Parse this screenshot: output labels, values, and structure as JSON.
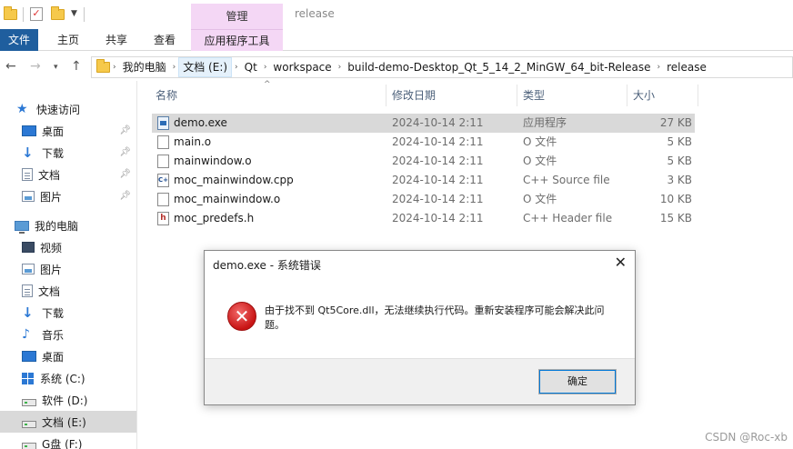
{
  "window": {
    "title": "release",
    "manage_tab": "管理"
  },
  "ribbon": {
    "tabs": [
      "文件",
      "主页",
      "共享",
      "查看",
      "应用程序工具"
    ]
  },
  "address": {
    "crumbs": [
      "我的电脑",
      "文档 (E:)",
      "Qt",
      "workspace",
      "build-demo-Desktop_Qt_5_14_2_MinGW_64_bit-Release",
      "release"
    ]
  },
  "sidebar": {
    "items": [
      {
        "label": "快速访问",
        "icon": "star-icon"
      },
      {
        "label": "桌面",
        "icon": "desktop-icon"
      },
      {
        "label": "下载",
        "icon": "download-icon"
      },
      {
        "label": "文档",
        "icon": "document-icon"
      },
      {
        "label": "图片",
        "icon": "picture-icon"
      },
      {
        "label": "我的电脑",
        "icon": "computer-icon"
      },
      {
        "label": "视频",
        "icon": "video-icon"
      },
      {
        "label": "图片",
        "icon": "picture-icon"
      },
      {
        "label": "文档",
        "icon": "document-icon"
      },
      {
        "label": "下载",
        "icon": "download-icon"
      },
      {
        "label": "音乐",
        "icon": "music-icon"
      },
      {
        "label": "桌面",
        "icon": "desktop-icon"
      },
      {
        "label": "系统 (C:)",
        "icon": "windows-drive-icon"
      },
      {
        "label": "软件 (D:)",
        "icon": "drive-icon"
      },
      {
        "label": "文档 (E:)",
        "icon": "drive-icon"
      },
      {
        "label": "G盘 (F:)",
        "icon": "drive-icon"
      }
    ]
  },
  "filelist": {
    "columns": {
      "name": "名称",
      "date": "修改日期",
      "type": "类型",
      "size": "大小"
    },
    "rows": [
      {
        "name": "demo.exe",
        "date": "2024-10-14 2:11",
        "type": "应用程序",
        "size": "27 KB",
        "icon": "exe-file-icon"
      },
      {
        "name": "main.o",
        "date": "2024-10-14 2:11",
        "type": "O 文件",
        "size": "5 KB",
        "icon": "generic-file-icon"
      },
      {
        "name": "mainwindow.o",
        "date": "2024-10-14 2:11",
        "type": "O 文件",
        "size": "5 KB",
        "icon": "generic-file-icon"
      },
      {
        "name": "moc_mainwindow.cpp",
        "date": "2024-10-14 2:11",
        "type": "C++ Source file",
        "size": "3 KB",
        "icon": "cpp-file-icon"
      },
      {
        "name": "moc_mainwindow.o",
        "date": "2024-10-14 2:11",
        "type": "O 文件",
        "size": "10 KB",
        "icon": "generic-file-icon"
      },
      {
        "name": "moc_predefs.h",
        "date": "2024-10-14 2:11",
        "type": "C++ Header file",
        "size": "15 KB",
        "icon": "header-file-icon"
      }
    ]
  },
  "dialog": {
    "title": "demo.exe - 系统错误",
    "message": "由于找不到 Qt5Core.dll，无法继续执行代码。重新安装程序可能会解决此问题。",
    "ok_label": "确定"
  },
  "watermark": "CSDN @Roc-xb"
}
